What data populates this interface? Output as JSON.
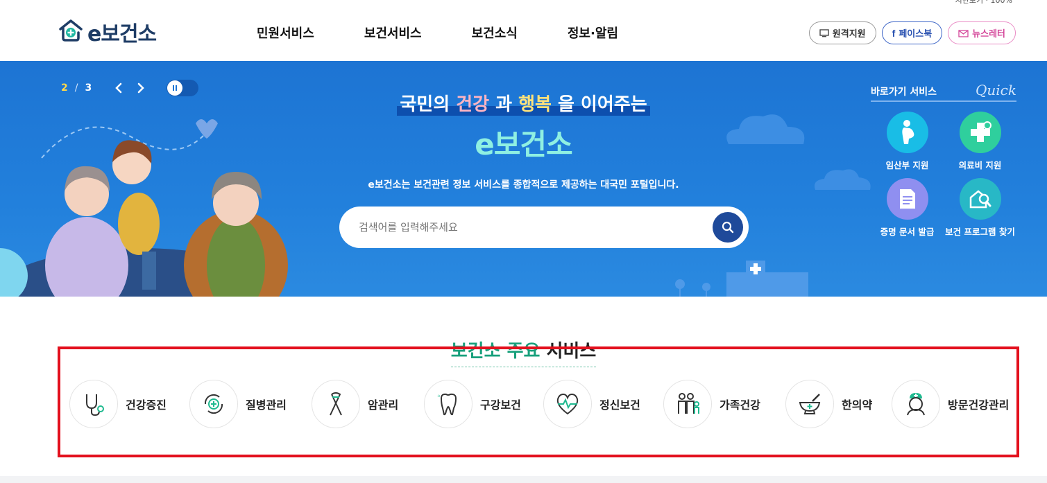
{
  "header": {
    "logo_text": "e보건소",
    "topline": "지난보기 · 100%",
    "nav": [
      "민원서비스",
      "보건서비스",
      "보건소식",
      "정보·알림"
    ],
    "util": [
      {
        "label": "원격지원",
        "icon": "monitor-icon"
      },
      {
        "label": "페이스북",
        "icon": "facebook-icon"
      },
      {
        "label": "뉴스레터",
        "icon": "mail-icon"
      }
    ]
  },
  "hero": {
    "pager": {
      "current": "2",
      "separator": "/",
      "total": "3"
    },
    "tagline_pre": "국민의 ",
    "tagline_w1": "건강",
    "tagline_mid": " 과 ",
    "tagline_w2": "행복",
    "tagline_post": " 을 이어주는",
    "main_title": "e보건소",
    "description": "e보건소는 보건관련 정보 서비스를 종합적으로 제공하는 대국민 포털입니다.",
    "search_placeholder": "검색어를 입력해주세요"
  },
  "quick": {
    "title": "바로가기 서비스",
    "script": "Quick",
    "items": [
      {
        "label": "임산부 지원",
        "color": "#19bde6",
        "icon": "pregnant-icon"
      },
      {
        "label": "의료비 지원",
        "color": "#2fcf9d",
        "icon": "medical-cross-icon"
      },
      {
        "label": "증명 문서 발급",
        "color": "#8f8ff0",
        "icon": "document-icon"
      },
      {
        "label": "보건 프로그램 찾기",
        "color": "#28b8c6",
        "icon": "search-program-icon"
      }
    ]
  },
  "services": {
    "title_accent": "보건소 주요",
    "title_rest": " 서비스",
    "items": [
      {
        "label": "건강증진",
        "icon": "stethoscope-icon"
      },
      {
        "label": "질병관리",
        "icon": "disease-cycle-icon"
      },
      {
        "label": "암관리",
        "icon": "ribbon-icon"
      },
      {
        "label": "구강보건",
        "icon": "tooth-icon"
      },
      {
        "label": "정신보건",
        "icon": "heart-pulse-icon"
      },
      {
        "label": "가족건강",
        "icon": "family-icon"
      },
      {
        "label": "한의약",
        "icon": "mortar-icon"
      },
      {
        "label": "방문건강관리",
        "icon": "nurse-icon"
      }
    ]
  },
  "colors": {
    "hero_bg": "#1d74d3",
    "accent_green": "#18a07c",
    "highlight_box": "#e3101d"
  }
}
